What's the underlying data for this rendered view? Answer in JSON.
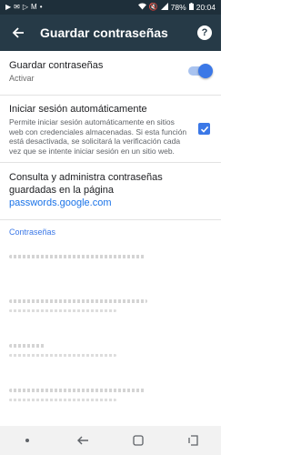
{
  "status": {
    "battery": "78%",
    "time": "20:04",
    "left_icons": [
      "youtube-icon",
      "mail-icon",
      "play-store-icon",
      "gmail-icon",
      "more-dots-icon"
    ],
    "right_icons": [
      "wifi-icon",
      "mute-icon",
      "signal-icon",
      "battery-icon"
    ]
  },
  "appbar": {
    "title": "Guardar contraseñas",
    "back_icon": "arrow-back-icon",
    "help_icon": "help-icon"
  },
  "save_passwords": {
    "title": "Guardar contraseñas",
    "subtitle": "Activar",
    "enabled": true
  },
  "auto_signin": {
    "title": "Iniciar sesión automáticamente",
    "description": "Permite iniciar sesión automáticamente en sitios web con credenciales almacenadas. Si esta función está desactivada, se solicitará la verificación cada vez que se intente iniciar sesión en un sitio web.",
    "checked": true
  },
  "manage": {
    "text": "Consulta y administra contraseñas guardadas en la página",
    "link": "passwords.google.com"
  },
  "passwords": {
    "section_label": "Contraseñas",
    "item_count": 4
  },
  "navbar": {
    "icons": [
      "dot-icon",
      "back-triangle-icon",
      "recents-square-icon",
      "recents-icon"
    ]
  },
  "colors": {
    "appbar": "#263a47",
    "statusbar": "#1e2f3a",
    "accent": "#3b78e7",
    "link": "#1a73e8"
  }
}
